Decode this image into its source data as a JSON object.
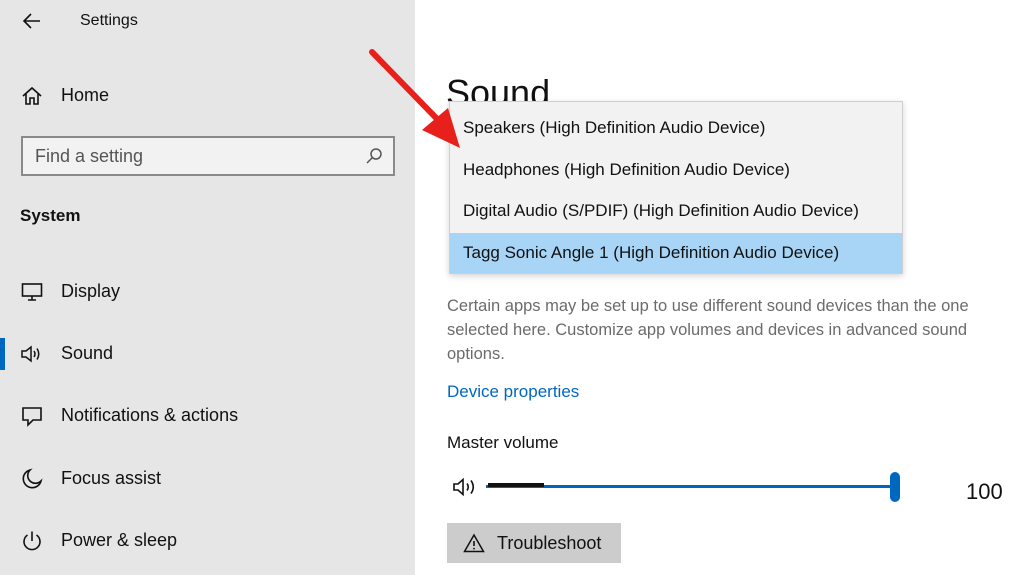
{
  "window": {
    "title": "Settings"
  },
  "sidebar": {
    "home_label": "Home",
    "search_placeholder": "Find a setting",
    "section_title": "System",
    "items": [
      {
        "label": "Display",
        "icon": "monitor-icon"
      },
      {
        "label": "Sound",
        "icon": "speaker-icon",
        "active": true
      },
      {
        "label": "Notifications & actions",
        "icon": "notification-icon"
      },
      {
        "label": "Focus assist",
        "icon": "moon-icon"
      },
      {
        "label": "Power & sleep",
        "icon": "power-icon"
      }
    ]
  },
  "main": {
    "title": "Sound",
    "output_dropdown": {
      "options": [
        "Speakers (High Definition Audio Device)",
        "Headphones (High Definition Audio Device)",
        "Digital Audio (S/PDIF) (High Definition Audio Device)",
        "Tagg Sonic Angle 1 (High Definition Audio Device)"
      ],
      "selected_index": 3
    },
    "description": "Certain apps may be set up to use different sound devices than the one selected here. Customize app volumes and devices in advanced sound options.",
    "device_properties_link": "Device properties",
    "master_volume_label": "Master volume",
    "master_volume_value": "100",
    "troubleshoot_label": "Troubleshoot"
  },
  "colors": {
    "accent": "#0067c0",
    "selected_option": "#a8d4f5",
    "annotation_arrow": "#e8201c"
  }
}
